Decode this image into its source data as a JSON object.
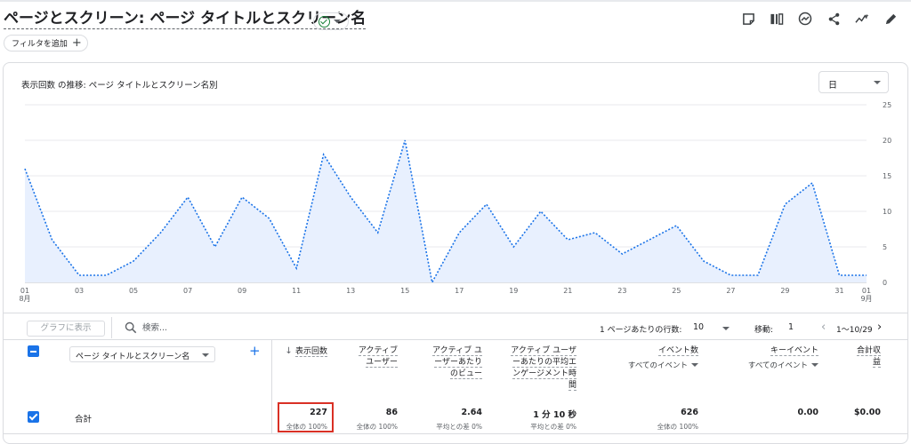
{
  "header": {
    "title": "ページとスクリーン: ページ タイトルとスクリーン名",
    "filter_chip": "フィルタを追加"
  },
  "chart": {
    "title": "表示回数 の推移: ページ タイトルとスクリーン名別",
    "granularity": "日"
  },
  "chart_data": {
    "type": "line",
    "x": [
      "08-01",
      "08-02",
      "08-03",
      "08-04",
      "08-05",
      "08-06",
      "08-07",
      "08-08",
      "08-09",
      "08-10",
      "08-11",
      "08-12",
      "08-13",
      "08-14",
      "08-15",
      "08-16",
      "08-17",
      "08-18",
      "08-19",
      "08-20",
      "08-21",
      "08-22",
      "08-23",
      "08-24",
      "08-25",
      "08-26",
      "08-27",
      "08-28",
      "08-29",
      "08-30",
      "08-31",
      "09-01"
    ],
    "values": [
      16,
      6,
      1,
      1,
      3,
      7,
      12,
      5,
      12,
      9,
      2,
      18,
      12,
      7,
      20,
      0,
      7,
      11,
      5,
      10,
      6,
      7,
      4,
      6,
      8,
      3,
      1,
      1,
      11,
      14,
      1,
      1
    ],
    "x_tick_labels": [
      "01",
      "03",
      "05",
      "07",
      "09",
      "11",
      "13",
      "15",
      "17",
      "19",
      "21",
      "23",
      "25",
      "27",
      "29",
      "31",
      "01"
    ],
    "x_month_labels": [
      "8月",
      "9月"
    ],
    "y_tick_labels": [
      "0",
      "5",
      "10",
      "15",
      "20",
      "25"
    ],
    "ylim": [
      0,
      25
    ],
    "grid": true,
    "color": "#1a73e8",
    "fill": "#e8f0fe"
  },
  "table_controls": {
    "graph_button": "グラフに表示",
    "search_placeholder": "検索...",
    "rows_label": "1 ページあたりの行数:",
    "rows_value": "10",
    "goto_label": "移動:",
    "goto_value": "1",
    "range": "1〜10/29"
  },
  "table": {
    "dimension": "ページ タイトルとスクリーン名",
    "columns": [
      {
        "label": [
          "表示回数"
        ],
        "sub": ""
      },
      {
        "label": [
          "アクティブ",
          "ユーザー"
        ],
        "sub": ""
      },
      {
        "label": [
          "アクティブ ユ",
          "ーザーあたり",
          "のビュー"
        ],
        "sub": ""
      },
      {
        "label": [
          "アクティブ ユーザ",
          "ーあたりの平均エ",
          "ンゲージメント時",
          "間"
        ],
        "sub": ""
      },
      {
        "label": [
          "イベント数"
        ],
        "sub": "すべてのイベント"
      },
      {
        "label": [
          "キーイベント"
        ],
        "sub": "すべてのイベント"
      },
      {
        "label": [
          "合計収",
          "益"
        ],
        "sub": ""
      }
    ],
    "total": {
      "label": "合計",
      "values": [
        "227",
        "86",
        "2.64",
        "1 分 10 秒",
        "626",
        "0.00",
        "$0.00"
      ],
      "subs": [
        "全体の 100%",
        "全体の 100%",
        "平均との差 0%",
        "平均との差 0%",
        "全体の 100%",
        "",
        ""
      ]
    }
  }
}
